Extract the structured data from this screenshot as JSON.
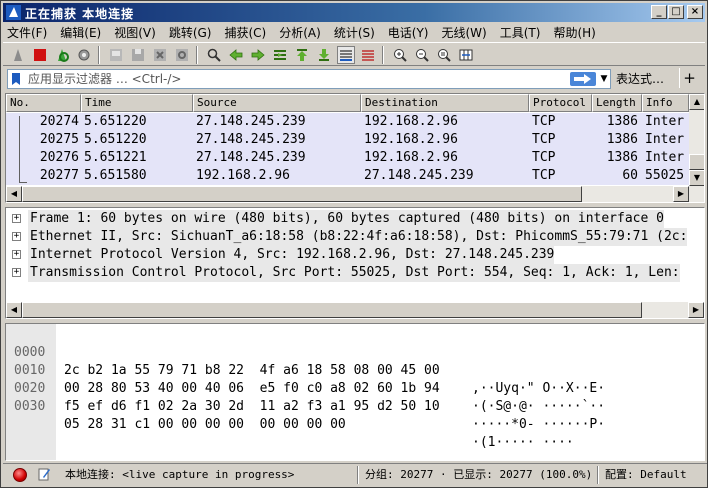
{
  "window": {
    "title": "正在捕获 本地连接",
    "minimize": "_",
    "maximize": "□",
    "close": "×"
  },
  "menu": [
    "文件(F)",
    "编辑(E)",
    "视图(V)",
    "跳转(G)",
    "捕获(C)",
    "分析(A)",
    "统计(S)",
    "电话(Y)",
    "无线(W)",
    "工具(T)",
    "帮助(H)"
  ],
  "filter": {
    "placeholder": "应用显示过滤器 … <Ctrl-/>",
    "expression_label": "表达式…",
    "add_label": "+"
  },
  "packet_list": {
    "columns": [
      "No.",
      "Time",
      "Source",
      "Destination",
      "Protocol",
      "Length",
      "Info"
    ],
    "rows": [
      {
        "no": "20274",
        "time": "5.651220",
        "source": "27.148.245.239",
        "destination": "192.168.2.96",
        "protocol": "TCP",
        "length": "1386",
        "info": "Inter"
      },
      {
        "no": "20275",
        "time": "5.651220",
        "source": "27.148.245.239",
        "destination": "192.168.2.96",
        "protocol": "TCP",
        "length": "1386",
        "info": "Inter"
      },
      {
        "no": "20276",
        "time": "5.651221",
        "source": "27.148.245.239",
        "destination": "192.168.2.96",
        "protocol": "TCP",
        "length": "1386",
        "info": "Inter"
      },
      {
        "no": "20277",
        "time": "5.651580",
        "source": "192.168.2.96",
        "destination": "27.148.245.239",
        "protocol": "TCP",
        "length": "60",
        "info": "55025"
      }
    ]
  },
  "details": [
    "Frame 1: 60 bytes on wire (480 bits), 60 bytes captured (480 bits) on interface 0",
    "Ethernet II, Src: SichuanT_a6:18:58 (b8:22:4f:a6:18:58), Dst: PhicommS_55:79:71 (2c:",
    "Internet Protocol Version 4, Src: 192.168.2.96, Dst: 27.148.245.239",
    "Transmission Control Protocol, Src Port: 55025, Dst Port: 554, Seq: 1, Ack: 1, Len:"
  ],
  "bytes": [
    {
      "offset": "0000",
      "hex": "2c b2 1a 55 79 71 b8 22  4f a6 18 58 08 00 45 00",
      "ascii": ",··Uyq·\" O··X··E·"
    },
    {
      "offset": "0010",
      "hex": "00 28 80 53 40 00 40 06  e5 f0 c0 a8 02 60 1b 94",
      "ascii": "·(·S@·@· ·····`··"
    },
    {
      "offset": "0020",
      "hex": "f5 ef d6 f1 02 2a 30 2d  11 a2 f3 a1 95 d2 50 10",
      "ascii": "·····*0- ······P·"
    },
    {
      "offset": "0030",
      "hex": "05 28 31 c1 00 00 00 00  00 00 00 00",
      "ascii": "·(1····· ····"
    }
  ],
  "status": {
    "capture": "本地连接: <live capture in progress>",
    "packets": "分组: 20277 · 已显示: 20277 (100.0%)",
    "profile": "配置: Default"
  }
}
